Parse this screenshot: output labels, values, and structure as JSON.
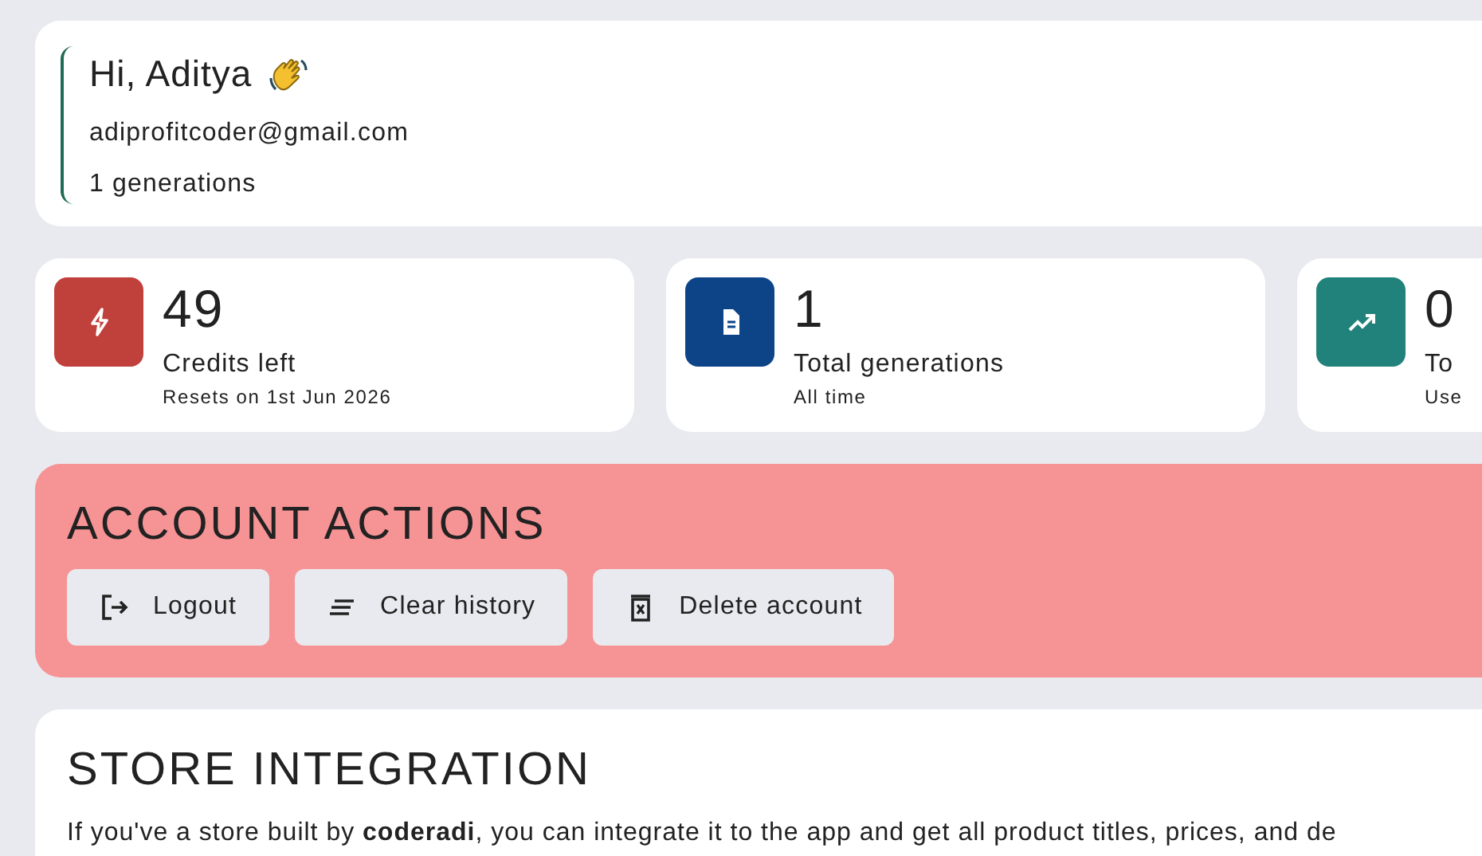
{
  "profile": {
    "greeting": "Hi, Aditya",
    "email": "adiprofitcoder@gmail.com",
    "generations": "1 generations"
  },
  "stats": [
    {
      "kind": "credits",
      "value": "49",
      "label": "Credits left",
      "note": "Resets on 1st Jun 2026",
      "color": "#c0403c"
    },
    {
      "kind": "generations",
      "value": "1",
      "label": "Total generations",
      "note": "All time",
      "color": "#0d4488"
    },
    {
      "kind": "trend",
      "value": "0",
      "label": "To",
      "note": "Use",
      "color": "#20827a"
    }
  ],
  "account_actions": {
    "title": "ACCOUNT ACTIONS",
    "buttons": [
      {
        "kind": "logout",
        "label": "Logout"
      },
      {
        "kind": "clear",
        "label": "Clear history"
      },
      {
        "kind": "delete",
        "label": "Delete account"
      }
    ]
  },
  "store_integration": {
    "title": "STORE INTEGRATION",
    "text": "If you've a store built by **coderadi**, you can integrate it to the app and get all product titles, prices, and de"
  }
}
